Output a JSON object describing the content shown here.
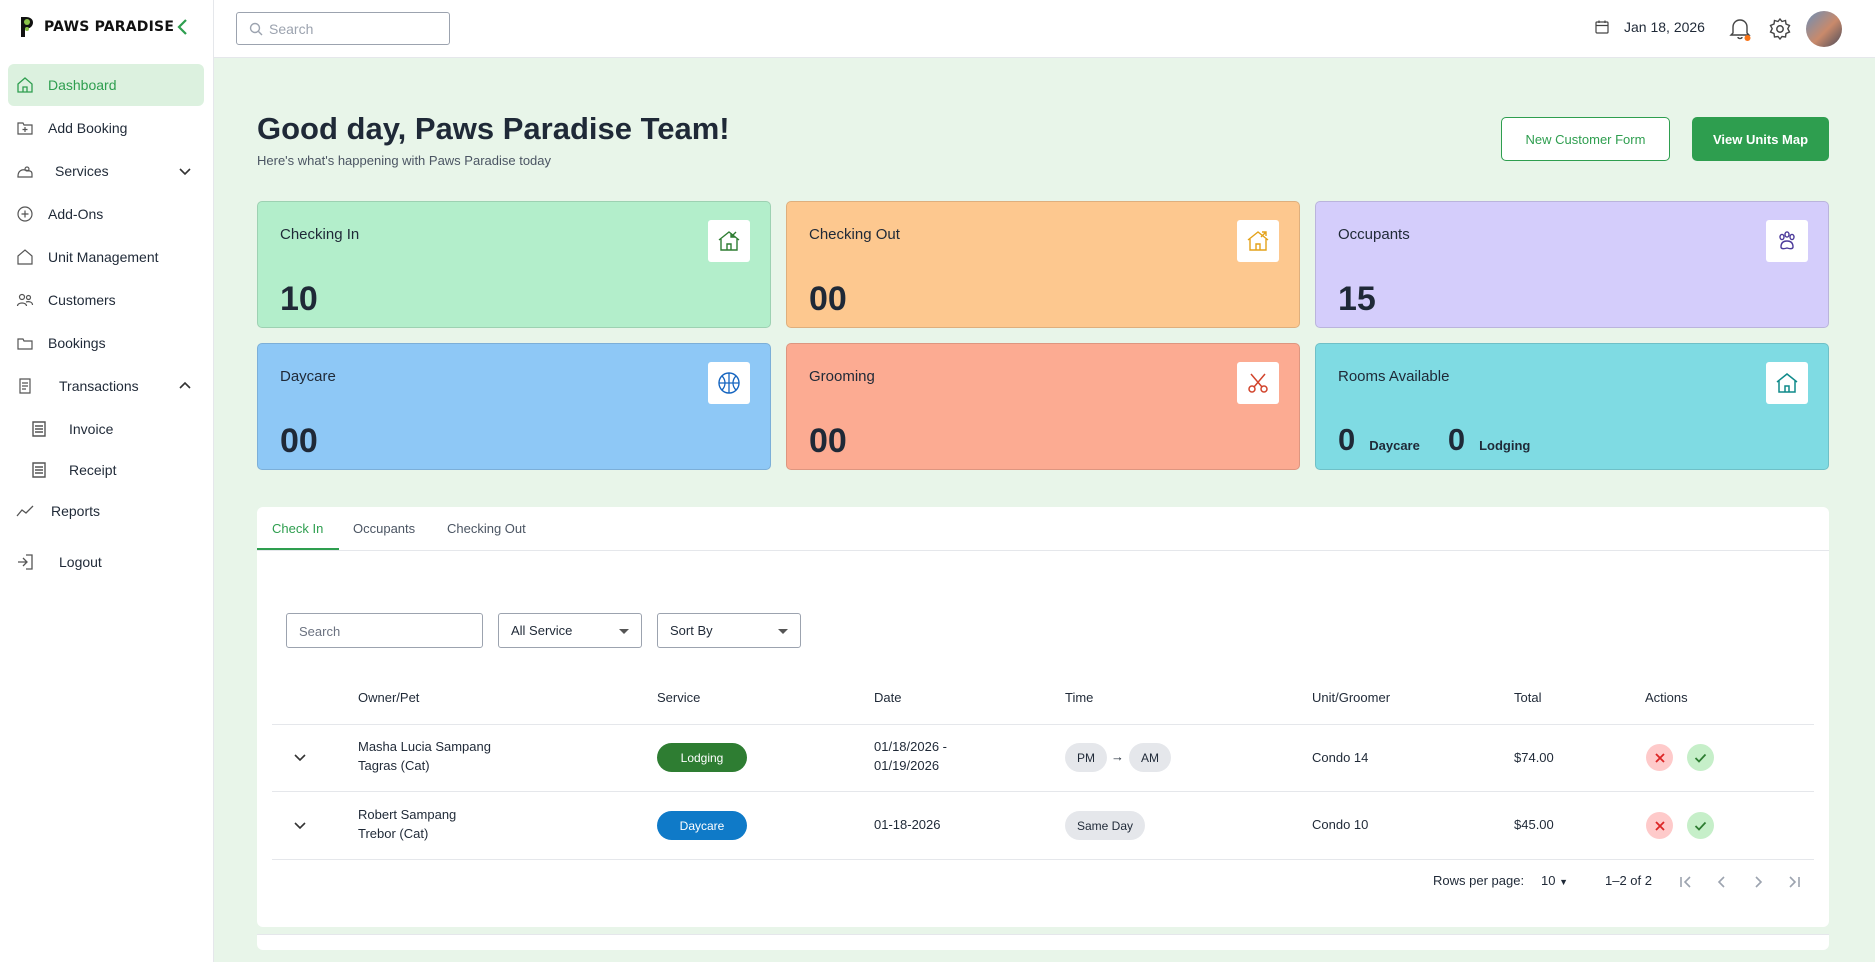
{
  "app": {
    "name": "PAWS PARADISE"
  },
  "sidebar": {
    "items": [
      {
        "label": "Dashboard"
      },
      {
        "label": "Add Booking"
      },
      {
        "label": "Services"
      },
      {
        "label": "Add-Ons"
      },
      {
        "label": "Unit Management"
      },
      {
        "label": "Customers"
      },
      {
        "label": "Bookings"
      },
      {
        "label": "Transactions"
      },
      {
        "label": "Invoice"
      },
      {
        "label": "Receipt"
      },
      {
        "label": "Reports"
      },
      {
        "label": "Logout"
      }
    ]
  },
  "topbar": {
    "search_placeholder": "Search",
    "date": "Jan 18, 2026"
  },
  "header": {
    "greeting": "Good day, Paws Paradise Team!",
    "subtitle": "Here's what's happening with Paws Paradise today",
    "new_customer_label": "New Customer Form",
    "view_units_label": "View Units Map"
  },
  "cards": [
    {
      "title": "Checking In",
      "value": "10",
      "color": "#b3eecb"
    },
    {
      "title": "Checking Out",
      "value": "00",
      "color": "#fdc88f"
    },
    {
      "title": "Occupants",
      "value": "15",
      "color": "#d4cdfb"
    },
    {
      "title": "Daycare",
      "value": "00",
      "color": "#8ec8f6"
    },
    {
      "title": "Grooming",
      "value": "00",
      "color": "#fcab92"
    },
    {
      "title": "Rooms Available",
      "daycare_value": "0",
      "daycare_label": "Daycare",
      "lodging_value": "0",
      "lodging_label": "Lodging",
      "color": "#7fdbe3"
    }
  ],
  "tabs": [
    {
      "label": "Check In",
      "active": true
    },
    {
      "label": "Occupants"
    },
    {
      "label": "Checking Out"
    }
  ],
  "filters": {
    "search_placeholder": "Search",
    "service": "All Service",
    "sort": "Sort By"
  },
  "table": {
    "headers": [
      "Owner/Pet",
      "Service",
      "Date",
      "Time",
      "Unit/Groomer",
      "Total",
      "Actions"
    ],
    "rows": [
      {
        "owner": "Masha Lucia Sampang",
        "pet": "Tagras (Cat)",
        "service": "Lodging",
        "service_color": "#2e7d32",
        "date_line1": "01/18/2026 -",
        "date_line2": "01/19/2026",
        "time_from": "PM",
        "time_to": "AM",
        "unit": "Condo 14",
        "total": "$74.00"
      },
      {
        "owner": "Robert Sampang",
        "pet": "Trebor (Cat)",
        "service": "Daycare",
        "service_color": "#0f7ac8",
        "date_line1": "01-18-2026",
        "time": "Same Day",
        "unit": "Condo 10",
        "total": "$45.00"
      }
    ]
  },
  "pagination": {
    "rows_label": "Rows per page:",
    "rows_value": "10",
    "range": "1–2 of 2"
  },
  "colors": {
    "accent": "#2e9e4f",
    "background": "#e8f5e9"
  }
}
